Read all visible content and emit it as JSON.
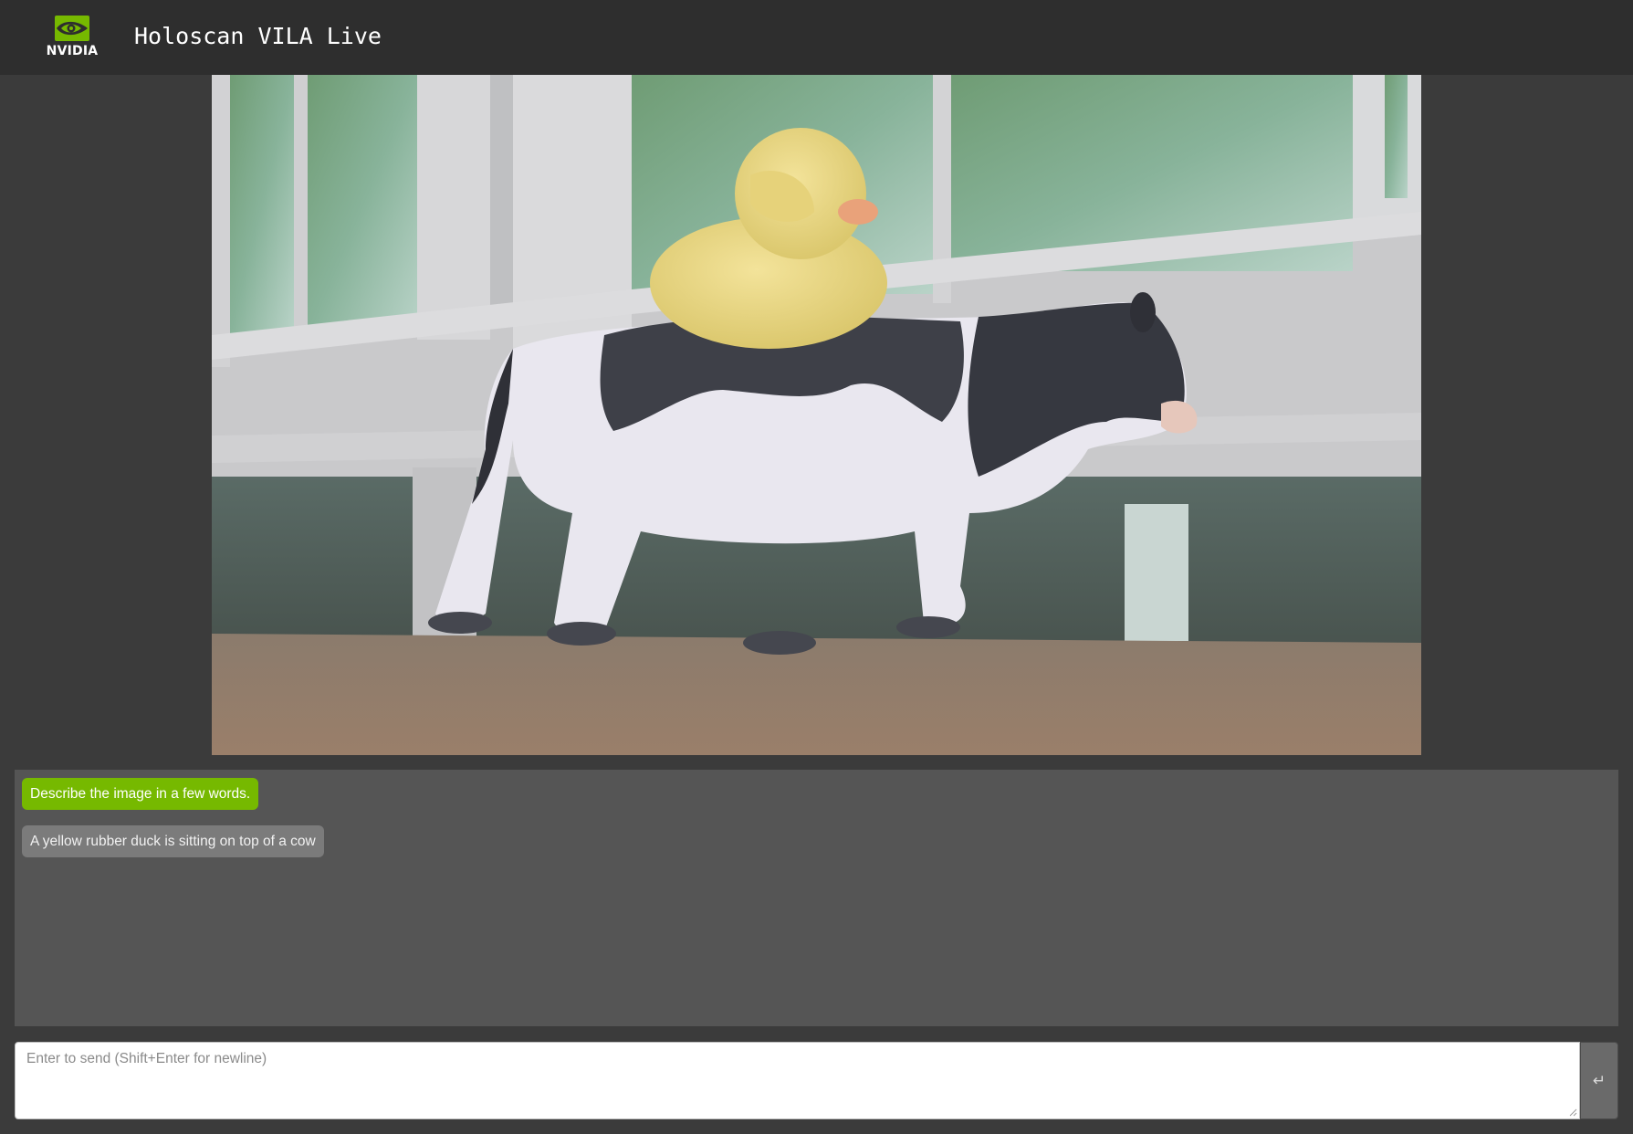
{
  "header": {
    "brand": "NVIDIA",
    "title": "Holoscan VILA Live",
    "logo_icon": "nvidia-eye-icon",
    "brand_color": "#76b900"
  },
  "video": {
    "content": "live-camera-frame"
  },
  "chat": {
    "messages": [
      {
        "role": "user",
        "text": "Describe the image in a few words."
      },
      {
        "role": "assistant",
        "text": "A yellow rubber duck is sitting on top of a cow"
      }
    ]
  },
  "input": {
    "value": "",
    "placeholder": "Enter to send (Shift+Enter for newline)",
    "send_icon": "return-arrow-icon",
    "send_glyph": "↵"
  }
}
